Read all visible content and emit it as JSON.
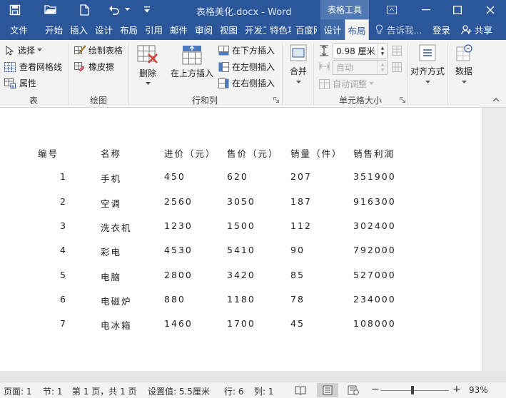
{
  "window": {
    "doc_title": "表格美化.docx - Word",
    "context_title": "表格工具"
  },
  "tabs": [
    {
      "label": "文件"
    },
    {
      "label": "开始"
    },
    {
      "label": "插入"
    },
    {
      "label": "设计"
    },
    {
      "label": "布局"
    },
    {
      "label": "引用"
    },
    {
      "label": "邮件"
    },
    {
      "label": "审阅"
    },
    {
      "label": "视图"
    },
    {
      "label": "开发工"
    },
    {
      "label": "特色功"
    },
    {
      "label": "百度网"
    },
    {
      "label": "设计"
    },
    {
      "label": "布局"
    }
  ],
  "tellme": "告诉我...",
  "login": "登录",
  "share": "共享",
  "ribbon": {
    "select": "选择",
    "view_gridlines": "查看网格线",
    "properties": "属性",
    "group_table": "表",
    "draw_table": "绘制表格",
    "eraser": "橡皮擦",
    "group_draw": "绘图",
    "delete": "删除",
    "insert_above": "在上方插入",
    "insert_below": "在下方插入",
    "insert_left": "在左侧插入",
    "insert_right": "在右侧插入",
    "group_rows_cols": "行和列",
    "merge": "合并",
    "height_value": "0.98 厘米",
    "width_value": "自动",
    "autofit": "自动调整",
    "group_cell_size": "单元格大小",
    "alignment": "对齐方式",
    "data": "数据"
  },
  "table": {
    "headers": [
      "编号",
      "名称",
      "进价（元）",
      "售价（元）",
      "销量（件）",
      "销售利润"
    ],
    "rows": [
      [
        "1",
        "手机",
        "450",
        "620",
        "207",
        "351900"
      ],
      [
        "2",
        "空调",
        "2560",
        "3050",
        "187",
        "916300"
      ],
      [
        "3",
        "洗衣机",
        "1230",
        "1500",
        "112",
        "302400"
      ],
      [
        "4",
        "彩电",
        "4530",
        "5410",
        "90",
        "792000"
      ],
      [
        "5",
        "电脑",
        "2800",
        "3420",
        "85",
        "527000"
      ],
      [
        "6",
        "电磁炉",
        "880",
        "1180",
        "78",
        "234000"
      ],
      [
        "7",
        "电冰箱",
        "1460",
        "1700",
        "45",
        "108000"
      ]
    ]
  },
  "status": {
    "page": "页面: 1",
    "section": "节: 1",
    "page_of": "第 1 页，共 1 页",
    "setting": "设置值: 5.5厘米",
    "row": "行: 6",
    "col": "列: 1",
    "zoom": "93%"
  },
  "colors": {
    "accent": "#2b579a",
    "context_tab": "#5379b4"
  }
}
